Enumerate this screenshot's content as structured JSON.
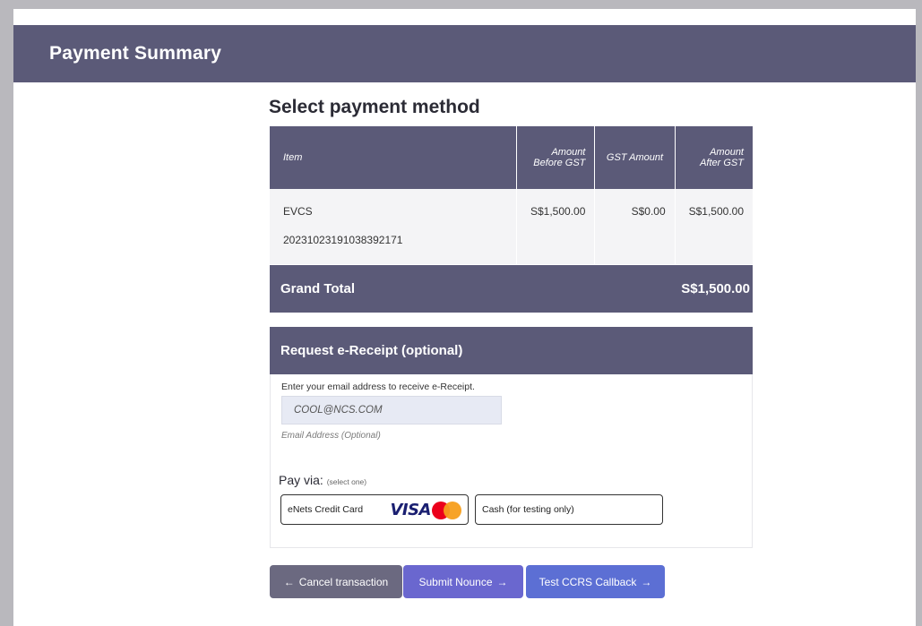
{
  "header": {
    "title": "Payment Summary"
  },
  "section_title": "Select payment method",
  "table": {
    "columns": [
      {
        "label": "Item"
      },
      {
        "label": "Amount Before GST",
        "line1": "Amount",
        "line2": "Before GST"
      },
      {
        "label": "GST Amount"
      },
      {
        "label": "Amount After GST",
        "line1": "Amount",
        "line2": "After GST"
      }
    ],
    "rows": [
      {
        "item_name": "EVCS",
        "item_ref": "20231023191038392171",
        "amount_before_gst": "S$1,500.00",
        "gst_amount": "S$0.00",
        "amount_after_gst": "S$1,500.00"
      }
    ]
  },
  "grand_total": {
    "label": "Grand Total",
    "value": "S$1,500.00"
  },
  "receipt": {
    "title": "Request e-Receipt (optional)",
    "hint": "Enter your email address to receive e-Receipt.",
    "email_value": "COOL@NCS.COM",
    "email_note": "Email Address (Optional)"
  },
  "pay_via": {
    "label": "Pay via:",
    "sub": "(select one)",
    "options": [
      {
        "label": "eNets Credit Card",
        "icons": [
          "visa-logo",
          "mastercard-logo"
        ]
      },
      {
        "label": "Cash (for testing only)"
      }
    ]
  },
  "cards": {
    "visa": "VISA",
    "mastercard": "MasterCard"
  },
  "buttons": {
    "cancel": "Cancel transaction",
    "submit": "Submit Nounce",
    "test": "Test CCRS Callback"
  },
  "colors": {
    "header_bg": "#5b5a78",
    "cancel_btn": "#6b6980",
    "submit_btn": "#6a67cf",
    "test_btn": "#5c6fd4",
    "input_bg": "#e7eaf4"
  }
}
